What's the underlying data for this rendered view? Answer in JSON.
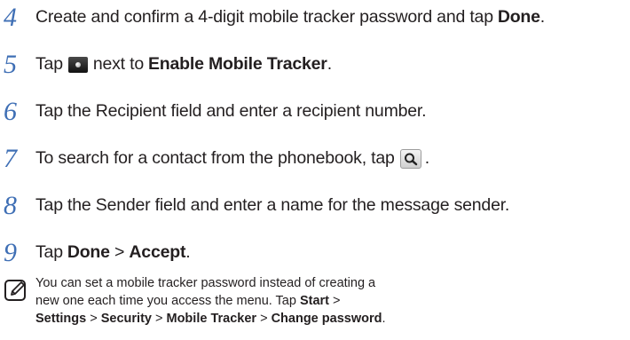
{
  "steps": [
    {
      "number": "4",
      "text": "Create and confirm a 4-digit mobile tracker password and tap ",
      "bold": "Done",
      "end": "."
    },
    {
      "number": "5",
      "before": "Tap",
      "after": "next to ",
      "bold": "Enable Mobile Tracker",
      "end": ".",
      "icon": "toggle-icon"
    },
    {
      "number": "6",
      "text": "Tap the Recipient field and enter a recipient number."
    },
    {
      "number": "7",
      "text": "To search for a contact from the phonebook, tap",
      "end": ".",
      "icon": "search-icon"
    },
    {
      "number": "8",
      "text": "Tap the Sender field and enter a name for the message sender."
    },
    {
      "number": "9",
      "before": "Tap ",
      "bold1": "Done",
      "sep": " > ",
      "bold2": "Accept",
      "end": "."
    }
  ],
  "note": {
    "icon": "note-pencil-icon",
    "line1": "You can set a mobile tracker password instead of creating a",
    "line2_text": "new one each time you access the menu. Tap ",
    "line2_bold": "Start",
    "line2_sep": " >",
    "line3_bold1": "Settings",
    "line3_sep1": " > ",
    "line3_bold2": "Security",
    "line3_sep2": " > ",
    "line3_bold3": "Mobile Tracker",
    "line3_sep3": " > ",
    "line3_bold4": "Change password",
    "line3_end": "."
  },
  "colors": {
    "step_number": "#3f6fb5",
    "text": "#231f20"
  }
}
